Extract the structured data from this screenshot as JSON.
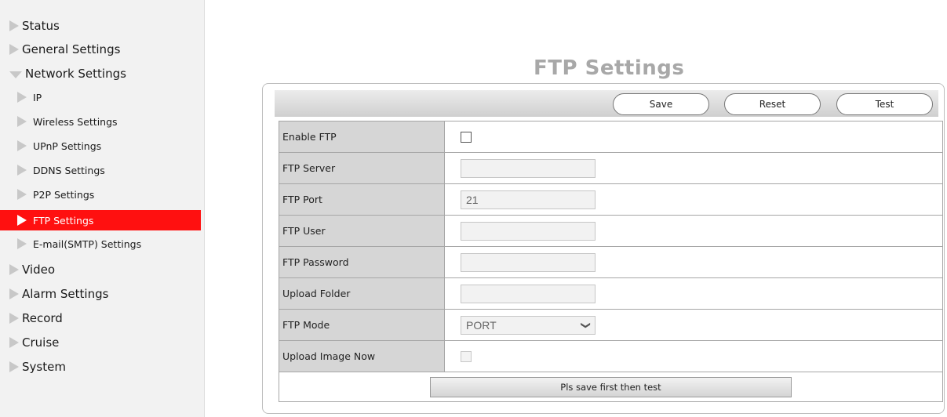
{
  "sidebar": {
    "items": [
      {
        "label": "Status"
      },
      {
        "label": "General Settings"
      },
      {
        "label": "Network Settings"
      },
      {
        "label": "IP"
      },
      {
        "label": "Wireless Settings"
      },
      {
        "label": "UPnP Settings"
      },
      {
        "label": "DDNS Settings"
      },
      {
        "label": "P2P Settings"
      },
      {
        "label": "FTP Settings",
        "active": true
      },
      {
        "label": "E-mail(SMTP) Settings"
      },
      {
        "label": "Video"
      },
      {
        "label": "Alarm Settings"
      },
      {
        "label": "Record"
      },
      {
        "label": "Cruise"
      },
      {
        "label": "System"
      }
    ]
  },
  "page": {
    "title": "FTP Settings"
  },
  "toolbar": {
    "save_label": "Save",
    "reset_label": "Reset",
    "test_label": "Test"
  },
  "form": {
    "enable_ftp": {
      "label": "Enable FTP",
      "checked": false
    },
    "ftp_server": {
      "label": "FTP Server",
      "value": ""
    },
    "ftp_port": {
      "label": "FTP Port",
      "value": "21"
    },
    "ftp_user": {
      "label": "FTP User",
      "value": ""
    },
    "ftp_password": {
      "label": "FTP Password",
      "value": ""
    },
    "upload_folder": {
      "label": "Upload Folder",
      "value": ""
    },
    "ftp_mode": {
      "label": "FTP Mode",
      "value": "PORT"
    },
    "upload_image_now": {
      "label": "Upload Image Now",
      "checked": false
    },
    "test_button_label": "Pls save first then test"
  },
  "colors": {
    "active_bg": "#ff1010",
    "title": "#a8a8a8",
    "label_bg": "#d6d6d6"
  },
  "icons": {
    "nav_arrow": "triangle-right-icon",
    "nav_expanded": "triangle-down-icon",
    "dropdown": "chevron-down-icon"
  }
}
